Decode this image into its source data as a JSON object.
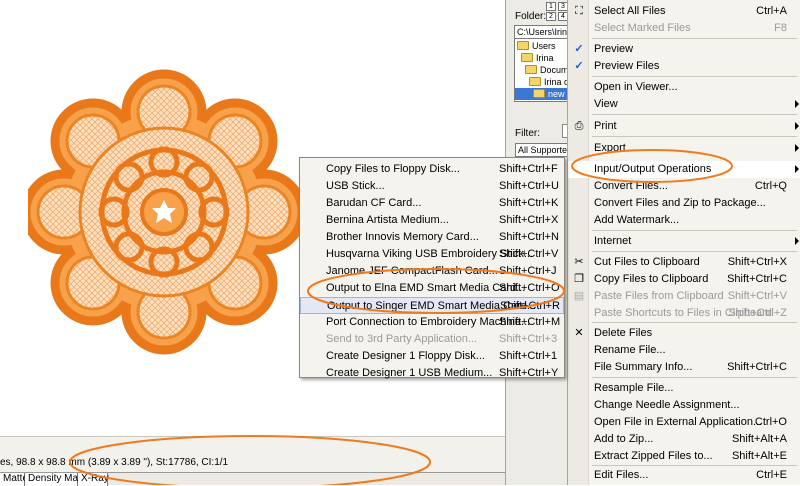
{
  "colors": {
    "accent_annotation": "#f07a1c",
    "embroidery": "#f08a1e",
    "selection": "#3a78d4"
  },
  "status": {
    "text": "es, 98.8 x 98.8 mm (3.89 x 3.89 \"), St:17786, CI:1/1"
  },
  "tabs": [
    "Matte",
    "Density Map",
    "X-Ray"
  ],
  "side_pane": {
    "folder_label": "Folder:",
    "numbers": [
      "1",
      "3",
      "2",
      "4"
    ],
    "path": "C:\\Users\\Irina",
    "tree": [
      "Users",
      "Irina",
      "Docum",
      "Irina d",
      "new"
    ],
    "filter_label": "Filter:",
    "filter_value": "All Supported"
  },
  "main_menu": {
    "items": [
      {
        "label": "Select All Files",
        "shortcut": "Ctrl+A",
        "icon": "select-all-icon"
      },
      {
        "label": "Select Marked Files",
        "shortcut": "F8",
        "disabled": true
      },
      {
        "label": "Preview",
        "icon": "check-icon"
      },
      {
        "label": "Preview Files",
        "icon": "check-icon"
      },
      {
        "label": "Open in Viewer..."
      },
      {
        "label": "View"
      },
      {
        "label": "Print",
        "icon": "printer-icon"
      },
      {
        "label": "Export"
      },
      {
        "label": "Input/Output Operations"
      },
      {
        "label": "Convert Files...",
        "shortcut": "Ctrl+Q"
      },
      {
        "label": "Convert Files and Zip to Package..."
      },
      {
        "label": "Add Watermark..."
      },
      {
        "label": "Internet"
      },
      {
        "label": "Cut Files to Clipboard",
        "shortcut": "Shift+Ctrl+X",
        "icon": "scissors-icon"
      },
      {
        "label": "Copy Files to Clipboard",
        "shortcut": "Shift+Ctrl+C",
        "icon": "copy-icon"
      },
      {
        "label": "Paste Files from Clipboard",
        "shortcut": "Shift+Ctrl+V",
        "disabled": true,
        "icon": "paste-icon"
      },
      {
        "label": "Paste Shortcuts to Files in Clipboard",
        "shortcut": "Shift+Ctrl+Z",
        "disabled": true
      },
      {
        "label": "Delete Files",
        "icon": "delete-icon"
      },
      {
        "label": "Rename File..."
      },
      {
        "label": "File Summary Info...",
        "shortcut": "Shift+Ctrl+C"
      },
      {
        "label": "Resample File..."
      },
      {
        "label": "Change Needle Assignment..."
      },
      {
        "label": "Open File in External Application...",
        "shortcut": "Ctrl+O"
      },
      {
        "label": "Add to Zip...",
        "shortcut": "Shift+Alt+A"
      },
      {
        "label": "Extract Zipped Files to...",
        "shortcut": "Shift+Alt+E"
      },
      {
        "label": "Edit Files...",
        "shortcut": "Ctrl+E"
      }
    ]
  },
  "submenu": {
    "items": [
      {
        "label": "Copy Files to Floppy Disk...",
        "shortcut": "Shift+Ctrl+F"
      },
      {
        "label": "USB Stick...",
        "shortcut": "Shift+Ctrl+U"
      },
      {
        "label": "Barudan CF Card...",
        "shortcut": "Shift+Ctrl+K"
      },
      {
        "label": "Bernina Artista Medium...",
        "shortcut": "Shift+Ctrl+X"
      },
      {
        "label": "Brother Innovis Memory Card...",
        "shortcut": "Shift+Ctrl+N"
      },
      {
        "label": "Husqvarna Viking USB Embroidery Stick...",
        "shortcut": "Shift+Ctrl+V"
      },
      {
        "label": "Janome JEF CompactFlash Card...",
        "shortcut": "Shift+Ctrl+J"
      },
      {
        "label": "Output to Elna EMD Smart Media Card...",
        "shortcut": "Shift+Ctrl+O"
      },
      {
        "label": "Output to Singer EMD Smart Media Card...",
        "shortcut": "Shift+Ctrl+R"
      },
      {
        "label": "Port Connection to Embroidery Machine...",
        "shortcut": "Shift+Ctrl+M"
      },
      {
        "label": "Send to 3rd Party Application...",
        "shortcut": "Shift+Ctrl+3",
        "disabled": true
      },
      {
        "label": "Create Designer 1 Floppy Disk...",
        "shortcut": "Shift+Ctrl+1"
      },
      {
        "label": "Create Designer 1 USB Medium...",
        "shortcut": "Shift+Ctrl+Y"
      }
    ]
  }
}
